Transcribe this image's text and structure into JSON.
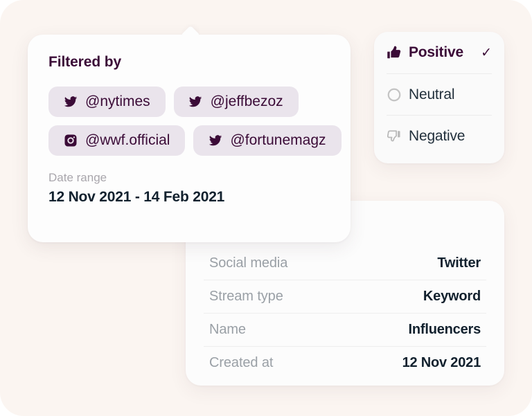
{
  "theme": {
    "background": "#fbf5f1",
    "card_background": "#ffffff",
    "accent_purple": "#3b0b37",
    "chip_background": "#eae4ec",
    "muted_text": "#9aa0a6",
    "dark_text": "#12212e"
  },
  "filter_panel": {
    "title": "Filtered by",
    "chips": [
      {
        "icon": "twitter-icon",
        "label": "@nytimes"
      },
      {
        "icon": "twitter-icon",
        "label": "@jeffbezoz"
      },
      {
        "icon": "instagram-icon",
        "label": "@wwf.official"
      },
      {
        "icon": "twitter-icon",
        "label": "@fortunemagz"
      }
    ],
    "date_range_label": "Date range",
    "date_range_value": "12 Nov 2021 - 14 Feb 2021"
  },
  "sentiment_panel": {
    "options": [
      {
        "icon": "thumbs-up-icon",
        "label": "Positive",
        "selected": true,
        "check": "✓"
      },
      {
        "icon": "circle-icon",
        "label": "Neutral",
        "selected": false,
        "check": ""
      },
      {
        "icon": "thumbs-down-icon",
        "label": "Negative",
        "selected": false,
        "check": ""
      }
    ]
  },
  "details_panel": {
    "rows": [
      {
        "label": "Social media",
        "value": "Twitter"
      },
      {
        "label": "Stream type",
        "value": "Keyword"
      },
      {
        "label": "Name",
        "value": "Influencers"
      },
      {
        "label": "Created at",
        "value": "12 Nov 2021"
      }
    ]
  }
}
